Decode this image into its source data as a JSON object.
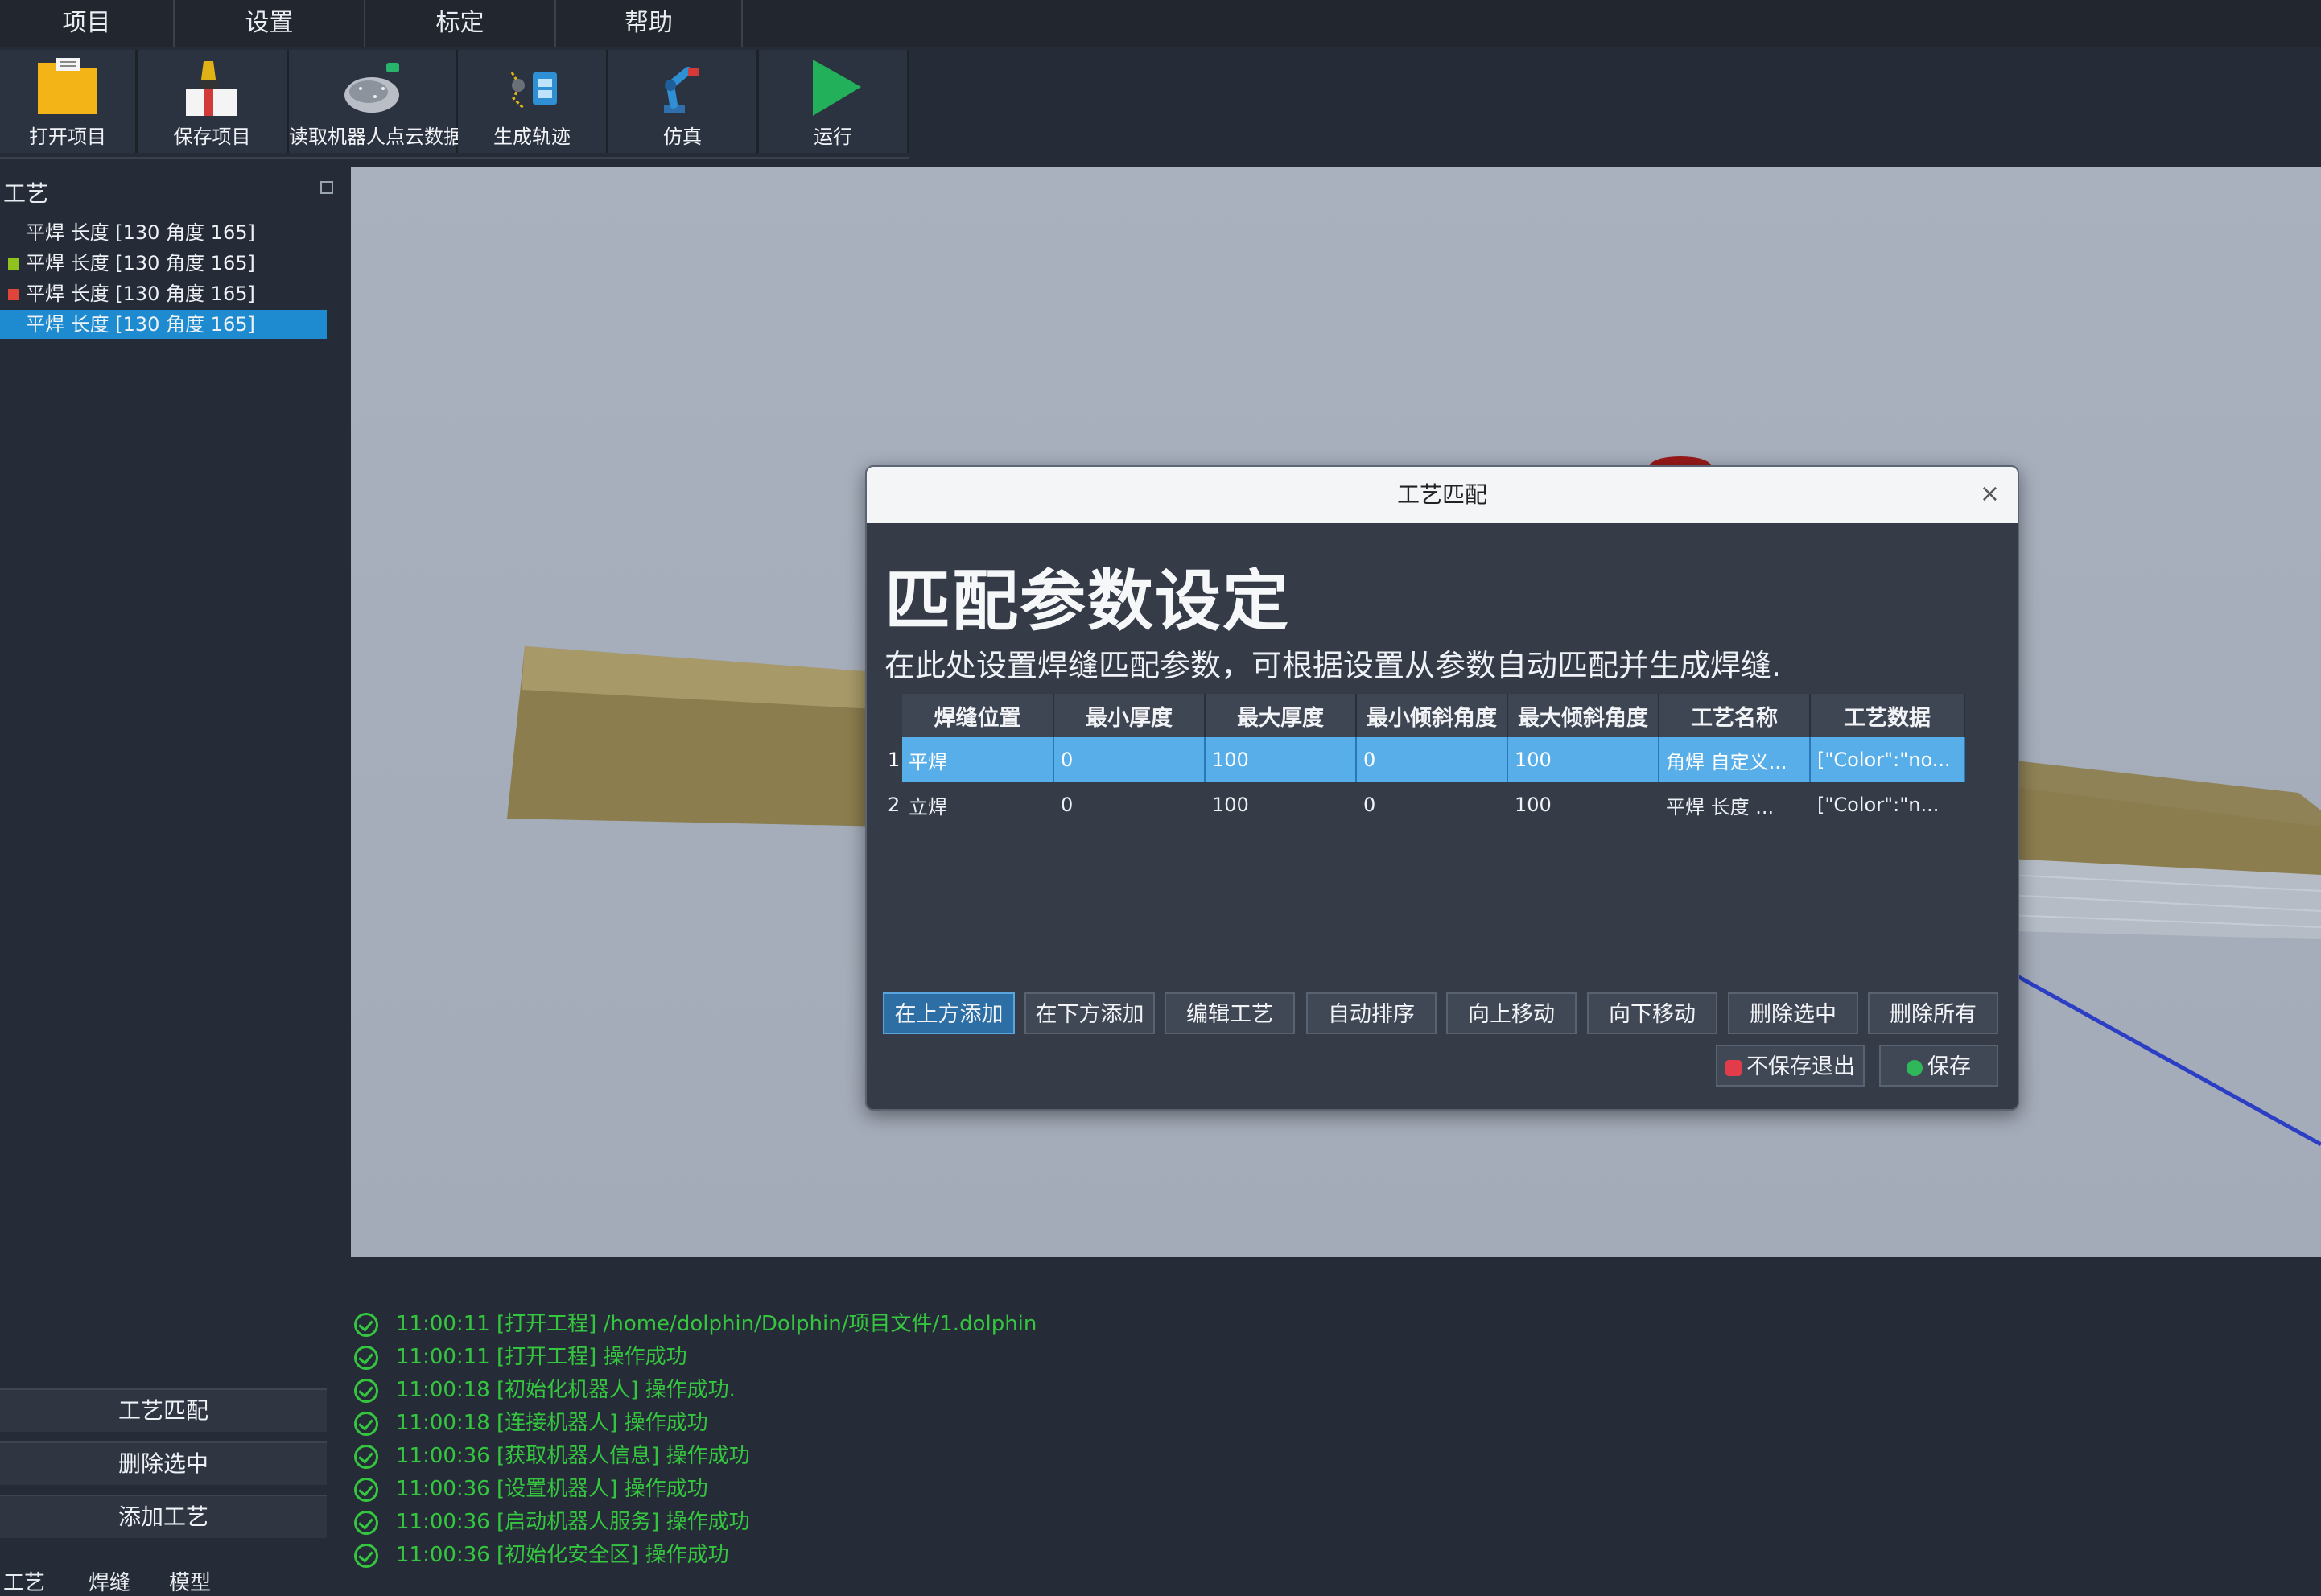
{
  "menu": [
    "项目",
    "设置",
    "标定",
    "帮助"
  ],
  "toolbar": [
    {
      "label": "打开项目",
      "icon": "folder-icon"
    },
    {
      "label": "保存项目",
      "icon": "save-icon"
    },
    {
      "label": "读取机器人点云数据",
      "icon": "point-cloud-icon"
    },
    {
      "label": "生成轨迹",
      "icon": "trajectory-icon"
    },
    {
      "label": "仿真",
      "icon": "robot-arm-icon"
    },
    {
      "label": "运行",
      "icon": "play-icon"
    }
  ],
  "left_panel": {
    "title": "工艺",
    "items": [
      {
        "label": "平焊 长度 [130 角度 165]",
        "marker": ""
      },
      {
        "label": "平焊 长度 [130 角度 165]",
        "marker": "#8fc41f"
      },
      {
        "label": "平焊 长度 [130 角度 165]",
        "marker": "#e0453a"
      },
      {
        "label": "平焊 长度 [130 角度 165]",
        "marker": ""
      }
    ],
    "buttons": [
      "工艺匹配",
      "删除选中",
      "添加工艺"
    ],
    "tabs": [
      "工艺",
      "焊缝",
      "模型"
    ]
  },
  "dialog": {
    "title": "工艺匹配",
    "close": "×",
    "heading": "匹配参数设定",
    "description": "在此处设置焊缝匹配参数，可根据设置从参数自动匹配并生成焊缝.",
    "columns": [
      "焊缝位置",
      "最小厚度",
      "最大厚度",
      "最小倾斜角度",
      "最大倾斜角度",
      "工艺名称",
      "工艺数据"
    ],
    "rows": [
      {
        "num": "1",
        "cells": [
          "平焊",
          "0",
          "100",
          "0",
          "100",
          "角焊 自定义...",
          "[\"Color\":\"no..."
        ]
      },
      {
        "num": "2",
        "cells": [
          "立焊",
          "0",
          "100",
          "0",
          "100",
          "平焊 长度 ...",
          "[\"Color\":\"n..."
        ]
      }
    ],
    "buttons": [
      "在上方添加",
      "在下方添加",
      "编辑工艺",
      "自动排序",
      "向上移动",
      "向下移动",
      "删除选中",
      "删除所有"
    ],
    "footer": {
      "cancel": "不保存退出",
      "save": "保存"
    }
  },
  "log": [
    "11:00:11 [打开工程] /home/dolphin/Dolphin/项目文件/1.dolphin",
    "11:00:11 [打开工程] 操作成功",
    "11:00:18 [初始化机器人] 操作成功.",
    "11:00:18 [连接机器人] 操作成功",
    "11:00:36 [获取机器人信息] 操作成功",
    "11:00:36 [设置机器人] 操作成功",
    "11:00:36 [启动机器人服务] 操作成功",
    "11:00:36 [初始化安全区] 操作成功"
  ],
  "colors": {
    "accent": "#1e8bd0",
    "success": "#35c63f",
    "selected_row": "#57aee9"
  }
}
